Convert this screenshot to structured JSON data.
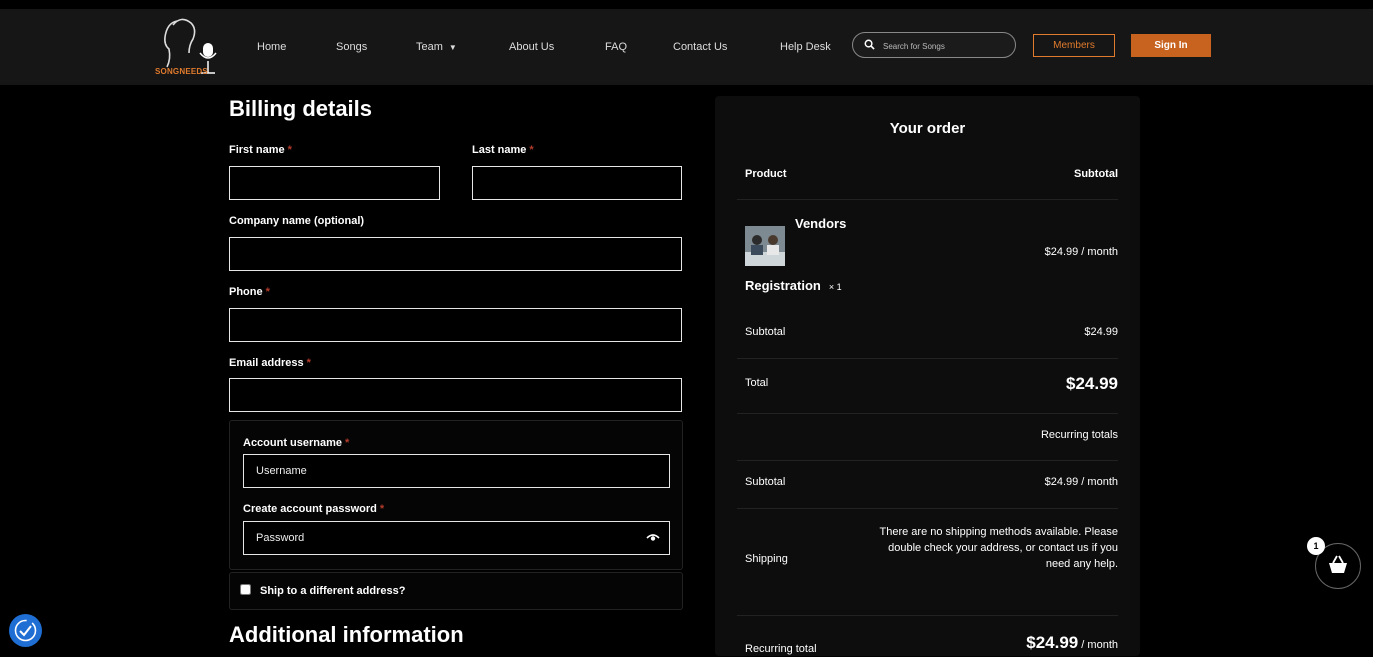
{
  "header": {
    "logo_text": "SONGNEEDS",
    "nav": [
      "Home",
      "Songs",
      "Team",
      "About Us",
      "FAQ",
      "Contact Us",
      "Help Desk"
    ],
    "search_placeholder": "Search for Songs",
    "members_label": "Members",
    "signin_label": "Sign In"
  },
  "billing": {
    "title": "Billing details",
    "first_name_label": "First name",
    "last_name_label": "Last name",
    "company_label": "Company name (optional)",
    "phone_label": "Phone",
    "email_label": "Email address",
    "username_label": "Account username",
    "username_placeholder": "Username",
    "password_label": "Create account password",
    "password_placeholder": "Password",
    "required_mark": "*",
    "ship_label": "Ship to a different address?",
    "additional_title": "Additional information"
  },
  "order": {
    "title": "Your order",
    "col_product": "Product",
    "col_subtotal": "Subtotal",
    "product_name_line1": "Vendors",
    "product_name_line2": "Registration",
    "product_qty": "× 1",
    "product_price": "$24.99",
    "per_month": " / month",
    "subtotal_label": "Subtotal",
    "subtotal_value": "$24.99",
    "total_label": "Total",
    "total_value": "$24.99",
    "recurring_totals": "Recurring totals",
    "recurring_subtotal_label": "Subtotal",
    "recurring_subtotal_value": "$24.99",
    "shipping_label": "Shipping",
    "shipping_note": "There are no shipping methods available. Please double check your address, or contact us if you need any help.",
    "recurring_total_label": "Recurring total",
    "recurring_total_value": "$24.99"
  },
  "cart": {
    "count": "1"
  },
  "colors": {
    "accent": "#e07a2c",
    "signin_bg": "#c8621f",
    "a11y": "#1f6ed4"
  }
}
